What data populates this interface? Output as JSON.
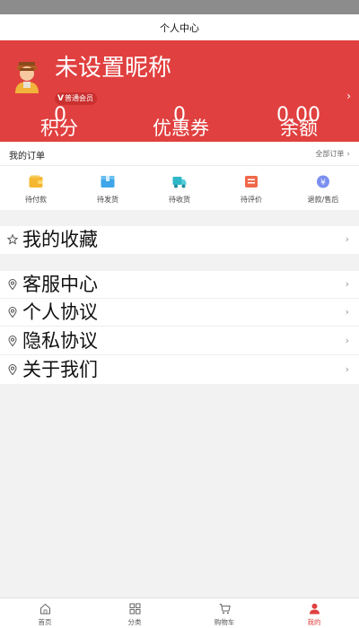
{
  "header": {
    "title": "个人中心"
  },
  "profile": {
    "nickname": "未设置昵称",
    "member_badge": "普通会员",
    "member_badge_mark": "V",
    "stats": [
      {
        "value": "0",
        "label": "积分"
      },
      {
        "value": "0",
        "label": "优惠券"
      },
      {
        "value": "0.00",
        "label": "余额"
      }
    ],
    "arrow": "›"
  },
  "orders": {
    "title": "我的订单",
    "all_label": "全部订单",
    "all_arrow": "›",
    "items": [
      {
        "label": "待付款",
        "icon": "wallet-icon",
        "color": "#f5b731"
      },
      {
        "label": "待发货",
        "icon": "package-icon",
        "color": "#3ea6e8"
      },
      {
        "label": "待收货",
        "icon": "truck-icon",
        "color": "#2fb7c7"
      },
      {
        "label": "待评价",
        "icon": "review-icon",
        "color": "#f0684a"
      },
      {
        "label": "退款/售后",
        "icon": "refund-icon",
        "color": "#7b8ff0"
      }
    ]
  },
  "favorites": {
    "label": "我的收藏",
    "icon": "star-icon",
    "arrow": "›"
  },
  "menu": [
    {
      "label": "客服中心",
      "icon": "location-pin-icon",
      "arrow": "›"
    },
    {
      "label": "个人协议",
      "icon": "location-pin-icon",
      "arrow": "›"
    },
    {
      "label": "隐私协议",
      "icon": "location-pin-icon",
      "arrow": "›"
    },
    {
      "label": "关于我们",
      "icon": "location-pin-icon",
      "arrow": "›"
    }
  ],
  "tabbar": {
    "items": [
      {
        "label": "首页",
        "icon": "home-icon",
        "active": false
      },
      {
        "label": "分类",
        "icon": "grid-icon",
        "active": false
      },
      {
        "label": "购物车",
        "icon": "cart-icon",
        "active": false
      },
      {
        "label": "我的",
        "icon": "user-icon",
        "active": true
      }
    ],
    "active_color": "#e0403f"
  },
  "colors": {
    "brand": "#e0403f",
    "background": "#f2f2f2"
  }
}
